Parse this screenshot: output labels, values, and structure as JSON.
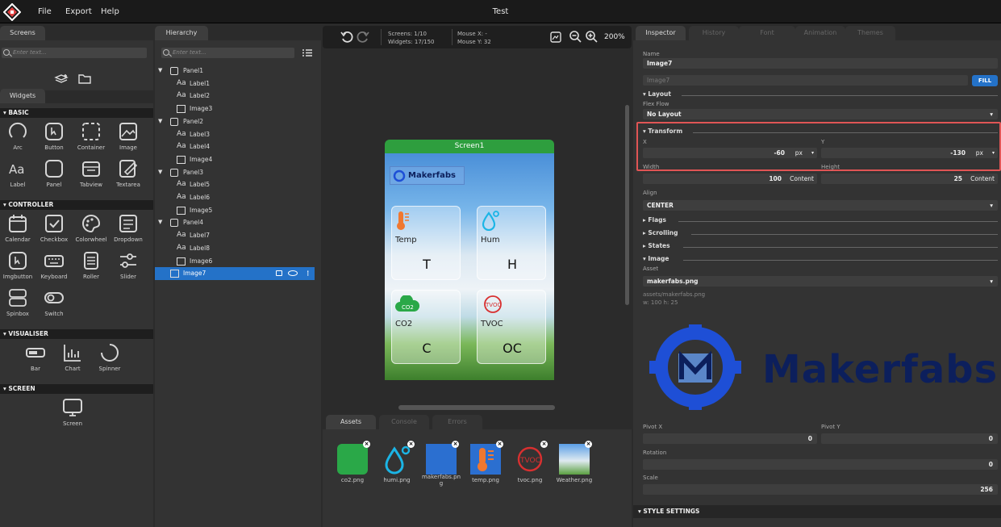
{
  "menu": {
    "file": "File",
    "export": "Export",
    "help": "Help"
  },
  "window_title": "Test",
  "left_panel": {
    "tab_screens": "Screens",
    "search_placeholder": "Enter text...",
    "tab_widgets": "Widgets",
    "categories": {
      "basic": "BASIC",
      "controller": "CONTROLLER",
      "visualiser": "VISUALISER",
      "screen": "SCREEN"
    },
    "basic": [
      "Arc",
      "Button",
      "Container",
      "Image",
      "Label",
      "Panel",
      "Tabview",
      "Textarea"
    ],
    "controller": [
      "Calendar",
      "Checkbox",
      "Colorwheel",
      "Dropdown",
      "Imgbutton",
      "Keyboard",
      "Roller",
      "Slider",
      "Spinbox",
      "Switch"
    ],
    "visualiser": [
      "Bar",
      "Chart",
      "Spinner"
    ],
    "screen": [
      "Screen"
    ]
  },
  "hierarchy": {
    "tab": "Hierarchy",
    "search_placeholder": "Enter text...",
    "items": [
      {
        "label": "Panel1",
        "kind": "panel"
      },
      {
        "label": "Label1",
        "kind": "label"
      },
      {
        "label": "Label2",
        "kind": "label"
      },
      {
        "label": "Image3",
        "kind": "image"
      },
      {
        "label": "Panel2",
        "kind": "panel"
      },
      {
        "label": "Label3",
        "kind": "label"
      },
      {
        "label": "Label4",
        "kind": "label"
      },
      {
        "label": "Image4",
        "kind": "image"
      },
      {
        "label": "Panel3",
        "kind": "panel"
      },
      {
        "label": "Label5",
        "kind": "label"
      },
      {
        "label": "Label6",
        "kind": "label"
      },
      {
        "label": "Image5",
        "kind": "image"
      },
      {
        "label": "Panel4",
        "kind": "panel"
      },
      {
        "label": "Label7",
        "kind": "label"
      },
      {
        "label": "Label8",
        "kind": "label"
      },
      {
        "label": "Image6",
        "kind": "image"
      },
      {
        "label": "Image7",
        "kind": "image",
        "selected": true
      }
    ]
  },
  "canvas": {
    "screens": "Screens: 1/10",
    "widgets": "Widgets: 17/150",
    "mouse_x": "Mouse X: -",
    "mouse_y": "Mouse Y: 32",
    "zoom": "200%",
    "screen_title": "Screen1",
    "logo_text": "Makerfabs",
    "cards": [
      {
        "label": "Temp",
        "value": "T"
      },
      {
        "label": "Hum",
        "value": "H"
      },
      {
        "label": "CO2",
        "value": "C"
      },
      {
        "label": "TVOC",
        "value": "OC"
      }
    ]
  },
  "bottom": {
    "tabs": [
      "Assets",
      "Console",
      "Errors"
    ],
    "assets": [
      "co2.png",
      "humi.png",
      "makerfabs.png",
      "temp.png",
      "tvoc.png",
      "Weather.png"
    ]
  },
  "inspector": {
    "tabs": [
      "Inspector",
      "History",
      "Font Manager",
      "Animation",
      "Themes"
    ],
    "name_label": "Name",
    "name_value": "Image7",
    "name_placeholder": "Image7",
    "fill": "FILL",
    "layout_section": "Layout",
    "flex_flow_label": "Flex Flow",
    "flex_flow_value": "No Layout",
    "transform_section": "Transform",
    "x_label": "X",
    "x_value": "-60",
    "x_unit": "px",
    "y_label": "Y",
    "y_value": "-130",
    "y_unit": "px",
    "width_label": "Width",
    "width_value": "100",
    "width_unit": "Content",
    "height_label": "Height",
    "height_value": "25",
    "height_unit": "Content",
    "align_label": "Align",
    "align_value": "CENTER",
    "flags_section": "Flags",
    "scrolling_section": "Scrolling",
    "states_section": "States",
    "image_section": "Image",
    "asset_label": "Asset",
    "asset_value": "makerfabs.png",
    "asset_path": "assets/makerfabs.png",
    "asset_size": "w: 100  h: 25",
    "preview_text": "Makerfabs",
    "pivot_x_label": "Pivot X",
    "pivot_x_value": "0",
    "pivot_y_label": "Pivot Y",
    "pivot_y_value": "0",
    "rotation_label": "Rotation",
    "rotation_value": "0",
    "scale_label": "Scale",
    "scale_value": "256",
    "style_settings": "STYLE SETTINGS"
  },
  "colors": {
    "accent": "#2472c8",
    "screen_header": "#2e9e3e",
    "highlight": "#e05555"
  }
}
